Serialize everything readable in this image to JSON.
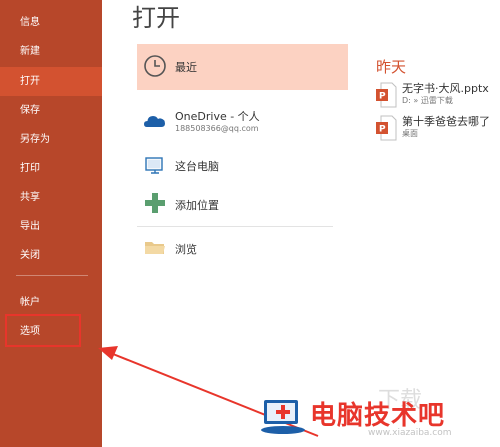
{
  "window": {
    "title": "打开"
  },
  "sidebar": {
    "items": [
      {
        "label": "信息",
        "active": false
      },
      {
        "label": "新建",
        "active": false
      },
      {
        "label": "打开",
        "active": true
      },
      {
        "label": "保存",
        "active": false
      },
      {
        "label": "另存为",
        "active": false
      },
      {
        "label": "打印",
        "active": false
      },
      {
        "label": "共享",
        "active": false
      },
      {
        "label": "导出",
        "active": false
      },
      {
        "label": "关闭",
        "active": false
      }
    ],
    "account_label": "帐户",
    "options_label": "选项"
  },
  "locations": [
    {
      "label": "最近",
      "icon": "clock-icon",
      "selected": true
    },
    {
      "label": "OneDrive - 个人",
      "sublabel": "188508366@qq.com",
      "icon": "onedrive-cloud-icon",
      "selected": false
    },
    {
      "label": "这台电脑",
      "icon": "computer-icon",
      "selected": false
    },
    {
      "label": "添加位置",
      "icon": "plus-icon",
      "selected": false
    },
    {
      "label": "浏览",
      "icon": "folder-icon",
      "selected": false
    }
  ],
  "recent": {
    "section_title": "昨天",
    "files": [
      {
        "name": "无字书·大风.pptx",
        "path": "D: » 迅雷下载",
        "icon": "pptx-file-icon"
      },
      {
        "name": "第十季爸爸去哪了",
        "path": "桌面",
        "icon": "pptx-file-icon"
      }
    ]
  },
  "watermark": {
    "text": "电脑技术吧",
    "ghost_text": "下载",
    "sub_text": "www.xiazaiba.com"
  },
  "colors": {
    "sidebar_bg": "#b7472a",
    "sidebar_active": "#d35230",
    "selected_location_bg": "#fcd2c2",
    "accent": "#d35230",
    "annotation_red": "#e8352b"
  }
}
